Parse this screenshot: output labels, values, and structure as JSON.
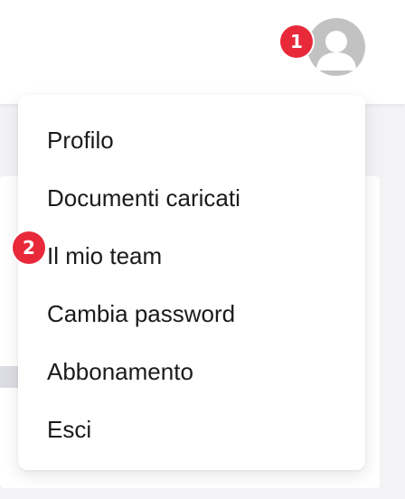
{
  "header": {
    "avatar_icon": "user-avatar-icon",
    "avatar_color": "#c2c2c2"
  },
  "badges": {
    "first": "1",
    "second": "2",
    "color": "#e8293a"
  },
  "user_menu": {
    "items": [
      {
        "label": "Profilo"
      },
      {
        "label": "Documenti caricati"
      },
      {
        "label": "Il mio team"
      },
      {
        "label": "Cambia password"
      },
      {
        "label": "Abbonamento"
      },
      {
        "label": "Esci"
      }
    ]
  }
}
